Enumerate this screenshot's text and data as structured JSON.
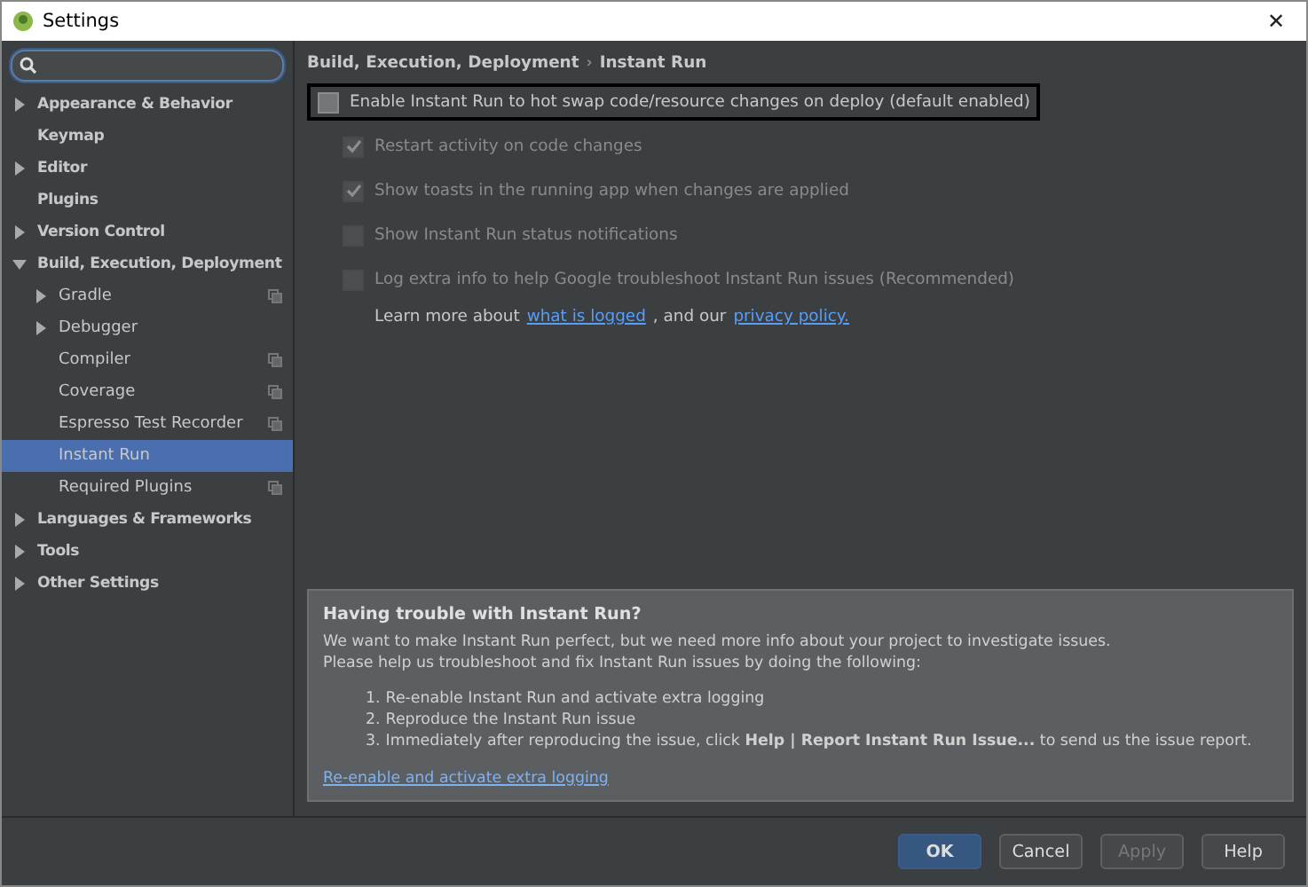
{
  "window": {
    "title": "Settings",
    "close": "✕"
  },
  "tree": [
    {
      "label": "Appearance & Behavior",
      "expanded": false,
      "selected": false
    },
    {
      "label": "Keymap",
      "selected": false
    },
    {
      "label": "Editor",
      "expanded": false,
      "selected": false
    },
    {
      "label": "Plugins",
      "selected": false
    },
    {
      "label": "Version Control",
      "expanded": false,
      "selected": false
    },
    {
      "label": "Build, Execution, Deployment",
      "expanded": true,
      "selected": false,
      "children": [
        {
          "label": "Gradle",
          "expanded": false,
          "selected": false,
          "project_icon": true
        },
        {
          "label": "Debugger",
          "expanded": false,
          "selected": false,
          "project_icon": false
        },
        {
          "label": "Compiler",
          "selected": false,
          "project_icon": true
        },
        {
          "label": "Coverage",
          "selected": false,
          "project_icon": true
        },
        {
          "label": "Espresso Test Recorder",
          "selected": false,
          "project_icon": true
        },
        {
          "label": "Instant Run",
          "selected": true,
          "project_icon": false
        },
        {
          "label": "Required Plugins",
          "selected": false,
          "project_icon": true
        }
      ]
    },
    {
      "label": "Languages & Frameworks",
      "expanded": false,
      "selected": false
    },
    {
      "label": "Tools",
      "expanded": false,
      "selected": false
    },
    {
      "label": "Other Settings",
      "expanded": false,
      "selected": false
    }
  ],
  "breadcrumb": [
    "Build, Execution, Deployment",
    "Instant Run"
  ],
  "breadcrumb_separator": "›",
  "options": [
    {
      "label": "Enable Instant Run to hot swap code/resource changes on deploy (default enabled)",
      "checked": false,
      "disabled": false,
      "focused": true,
      "indented": false
    },
    {
      "label": "Restart activity on code changes",
      "checked": true,
      "disabled": true,
      "focused": false,
      "indented": true
    },
    {
      "label": "Show toasts in the running app when changes are applied",
      "checked": true,
      "disabled": true,
      "focused": false,
      "indented": true
    },
    {
      "label": "Show Instant Run status notifications",
      "checked": false,
      "disabled": true,
      "focused": false,
      "indented": true
    },
    {
      "label": "Log extra info to help Google troubleshoot Instant Run issues (Recommended)",
      "checked": false,
      "disabled": true,
      "focused": false,
      "indented": true
    }
  ],
  "learn_more": [
    {
      "kind": "text",
      "text": "Learn more about"
    },
    {
      "kind": "link",
      "text": "what is logged"
    },
    {
      "kind": "text",
      "text": ", and our"
    },
    {
      "kind": "link",
      "text": "privacy policy."
    }
  ],
  "help_panel": {
    "title": "Having trouble with Instant Run?",
    "lines": [
      "We want to make Instant Run perfect, but we need more info about your project to investigate issues.",
      "Please help us troubleshoot and fix Instant Run issues by doing the following:"
    ],
    "steps": [
      {
        "number": "1.",
        "text": "Re-enable Instant Run and activate extra logging"
      },
      {
        "number": "2.",
        "text": "Reproduce the Instant Run issue"
      },
      {
        "number": "3.",
        "text": "Immediately after reproducing the issue, click **Help | Report Instant Run Issue...** to send us the issue report."
      }
    ],
    "link": "Re-enable and activate extra logging"
  },
  "buttons": [
    {
      "label": "OK",
      "kind": "primary",
      "disabled": false
    },
    {
      "label": "Cancel",
      "kind": "normal",
      "disabled": false
    },
    {
      "label": "Apply",
      "kind": "normal",
      "disabled": true
    },
    {
      "label": "Help",
      "kind": "normal",
      "disabled": false
    }
  ]
}
